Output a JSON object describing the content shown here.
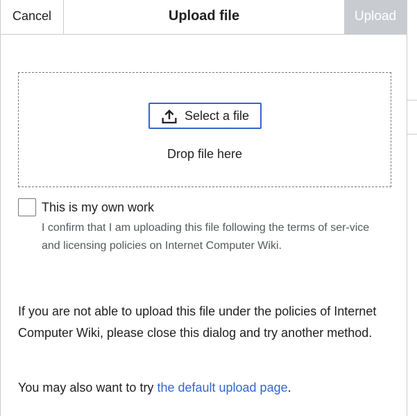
{
  "header": {
    "cancel_label": "Cancel",
    "title": "Upload file",
    "upload_label": "Upload"
  },
  "dropzone": {
    "select_label": "Select a file",
    "drop_text": "Drop file here"
  },
  "own_work": {
    "checked": false,
    "label": "This is my own work",
    "help": "I confirm that I am uploading this file following the terms of ser-vice and licensing policies on Internet Computer Wiki."
  },
  "notice": {
    "paragraph": "If you are not able to upload this file under the policies of Internet Computer Wiki, please close this dialog and try another method.",
    "alt_prefix": "You may also want to try ",
    "alt_link": "the default upload page",
    "alt_suffix": "."
  },
  "colors": {
    "accent": "#3366cc",
    "border": "#c8ccd1",
    "disabled_button": "#c8ccd1",
    "text": "#202122",
    "muted_text": "#54595d"
  },
  "icons": {
    "select_file": "upload-icon"
  }
}
